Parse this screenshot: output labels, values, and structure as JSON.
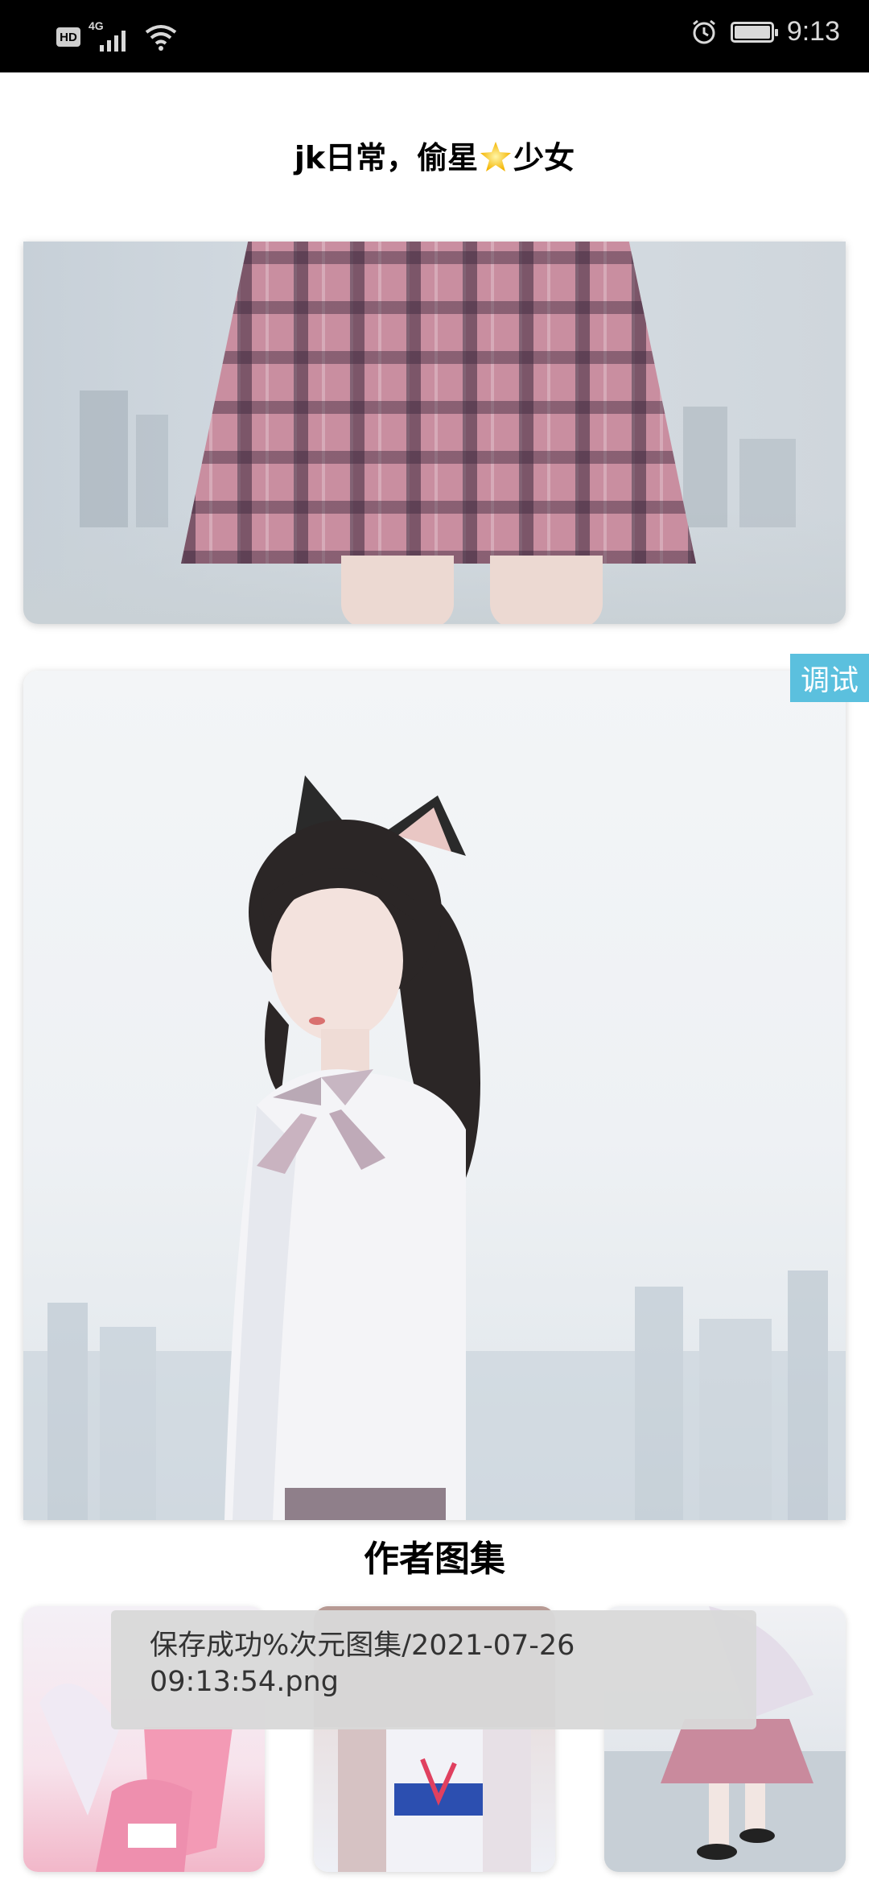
{
  "status_bar": {
    "hd": "HD",
    "network": "4G",
    "time": "9:13",
    "icons": [
      "hd-icon",
      "signal-icon",
      "wifi-icon",
      "alarm-icon",
      "battery-icon"
    ]
  },
  "header": {
    "title_prefix": "jk日常，偷星",
    "title_emoji": "star-emoji",
    "title_suffix": "少女"
  },
  "debug_button": {
    "label": "调试"
  },
  "section": {
    "title": "作者图集"
  },
  "toast": {
    "line1": "保存成功%次元图集/2021-07-26",
    "line2": "09:13:54.png"
  },
  "colors": {
    "status_bar_bg": "#000000",
    "debug_tab": "#5bc0de",
    "toast_bg": "#d8d8d8",
    "page_bg": "#ffffff"
  }
}
